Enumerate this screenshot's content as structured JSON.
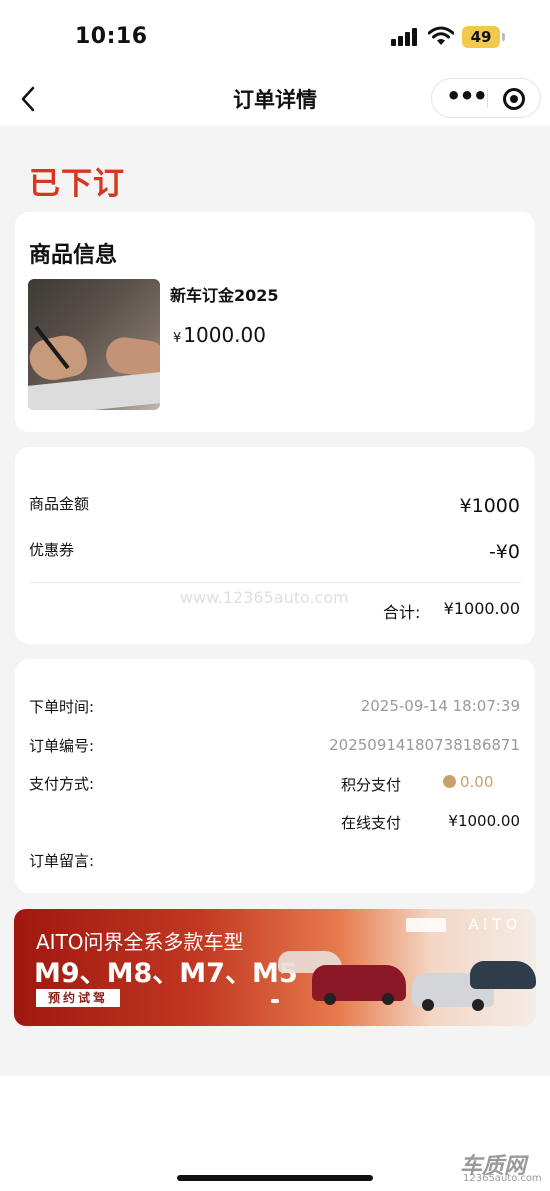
{
  "status_bar": {
    "time": "10:16",
    "battery": "49"
  },
  "nav": {
    "back_label": "<",
    "title": "订单详情",
    "more_label": "•••"
  },
  "order": {
    "status": "已下订"
  },
  "product": {
    "section_title": "商品信息",
    "name": "新车订金2025",
    "price_symbol": "¥",
    "price": "1000.00"
  },
  "amounts": {
    "goods_label": "商品金额",
    "goods_value": "¥1000",
    "coupon_label": "优惠券",
    "coupon_value": "-¥0",
    "total_label": "合计:",
    "total_value": "¥1000.00"
  },
  "info": {
    "time_label": "下单时间:",
    "time_value": "2025-09-14 18:07:39",
    "number_label": "订单编号:",
    "number_value": "20250914180738186871",
    "payment_label": "支付方式:",
    "points_label": "积分支付",
    "points_value": "0.00",
    "online_label": "在线支付",
    "online_value": "¥1000.00",
    "message_label": "订单留言:"
  },
  "banner": {
    "title": "AITO问界全系多款车型",
    "models": "M9、M8、M7、M5",
    "button": "预约试驾",
    "brand": "AITO"
  },
  "watermark": {
    "center": "www.12365auto.com",
    "logo": "车质网",
    "url": "12365auto.com"
  }
}
